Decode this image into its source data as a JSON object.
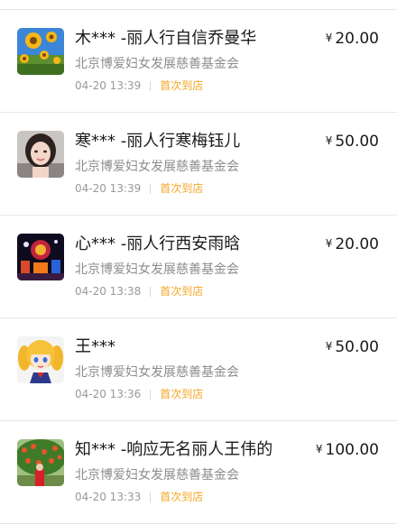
{
  "records": [
    {
      "avatar_icon": "sunflower-photo",
      "title": "木*** -丽人行自信乔曼华",
      "org": "北京博爱妇女发展慈善基金会",
      "time": "04-20 13:39",
      "badge": "首次到店",
      "currency": "¥",
      "amount": "20.00"
    },
    {
      "avatar_icon": "woman-portrait-photo",
      "title": "寒*** -丽人行寒梅钰儿",
      "org": "北京博爱妇女发展慈善基金会",
      "time": "04-20 13:39",
      "badge": "首次到店",
      "currency": "¥",
      "amount": "50.00"
    },
    {
      "avatar_icon": "night-lanterns-photo",
      "title": "心*** -丽人行西安雨晗",
      "org": "北京博爱妇女发展慈善基金会",
      "time": "04-20 13:38",
      "badge": "首次到店",
      "currency": "¥",
      "amount": "20.00"
    },
    {
      "avatar_icon": "anime-girl-avatar",
      "title": "王***",
      "org": "北京博爱妇女发展慈善基金会",
      "time": "04-20 13:36",
      "badge": "首次到店",
      "currency": "¥",
      "amount": "50.00"
    },
    {
      "avatar_icon": "fruit-tree-photo",
      "title": "知*** -响应无名丽人王伟的",
      "org": "北京博爱妇女发展慈善基金会",
      "time": "04-20 13:33",
      "badge": "首次到店",
      "currency": "¥",
      "amount": "100.00"
    }
  ],
  "colors": {
    "badge": "#f5a623",
    "title": "#1a1a1a",
    "secondary": "#8c8c8c",
    "divider": "#e6e6e6"
  }
}
